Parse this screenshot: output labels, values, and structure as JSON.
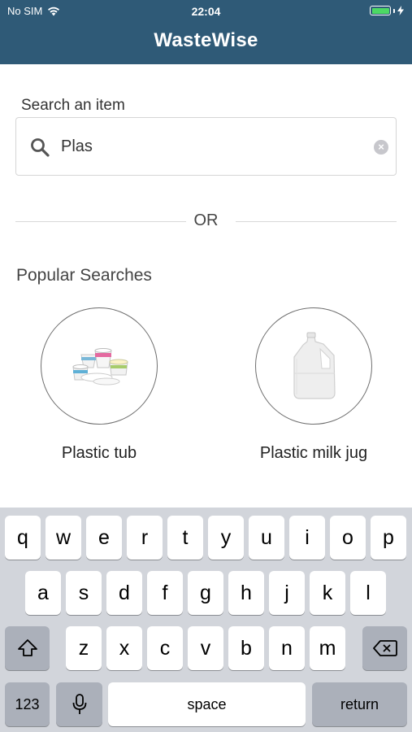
{
  "status_bar": {
    "carrier": "No SIM",
    "time": "22:04",
    "icons": [
      "wifi-icon",
      "battery-icon",
      "charging-bolt-icon"
    ]
  },
  "header": {
    "title": "WasteWise",
    "color": "#2f5a77"
  },
  "search": {
    "label": "Search an item",
    "value": "Plas",
    "icon": "search-icon",
    "clear_icon": "clear-icon"
  },
  "divider": {
    "text": "OR"
  },
  "popular": {
    "title": "Popular Searches",
    "items": [
      {
        "label": "Plastic tub",
        "image": "plastic-tubs-image"
      },
      {
        "label": "Plastic milk jug",
        "image": "plastic-milk-jug-image"
      }
    ]
  },
  "keyboard": {
    "row1": [
      "q",
      "w",
      "e",
      "r",
      "t",
      "y",
      "u",
      "i",
      "o",
      "p"
    ],
    "row2": [
      "a",
      "s",
      "d",
      "f",
      "g",
      "h",
      "j",
      "k",
      "l"
    ],
    "row3": [
      "z",
      "x",
      "c",
      "v",
      "b",
      "n",
      "m"
    ],
    "numbers_label": "123",
    "space_label": "space",
    "return_label": "return",
    "icons": [
      "shift-icon",
      "backspace-icon",
      "microphone-icon"
    ]
  }
}
